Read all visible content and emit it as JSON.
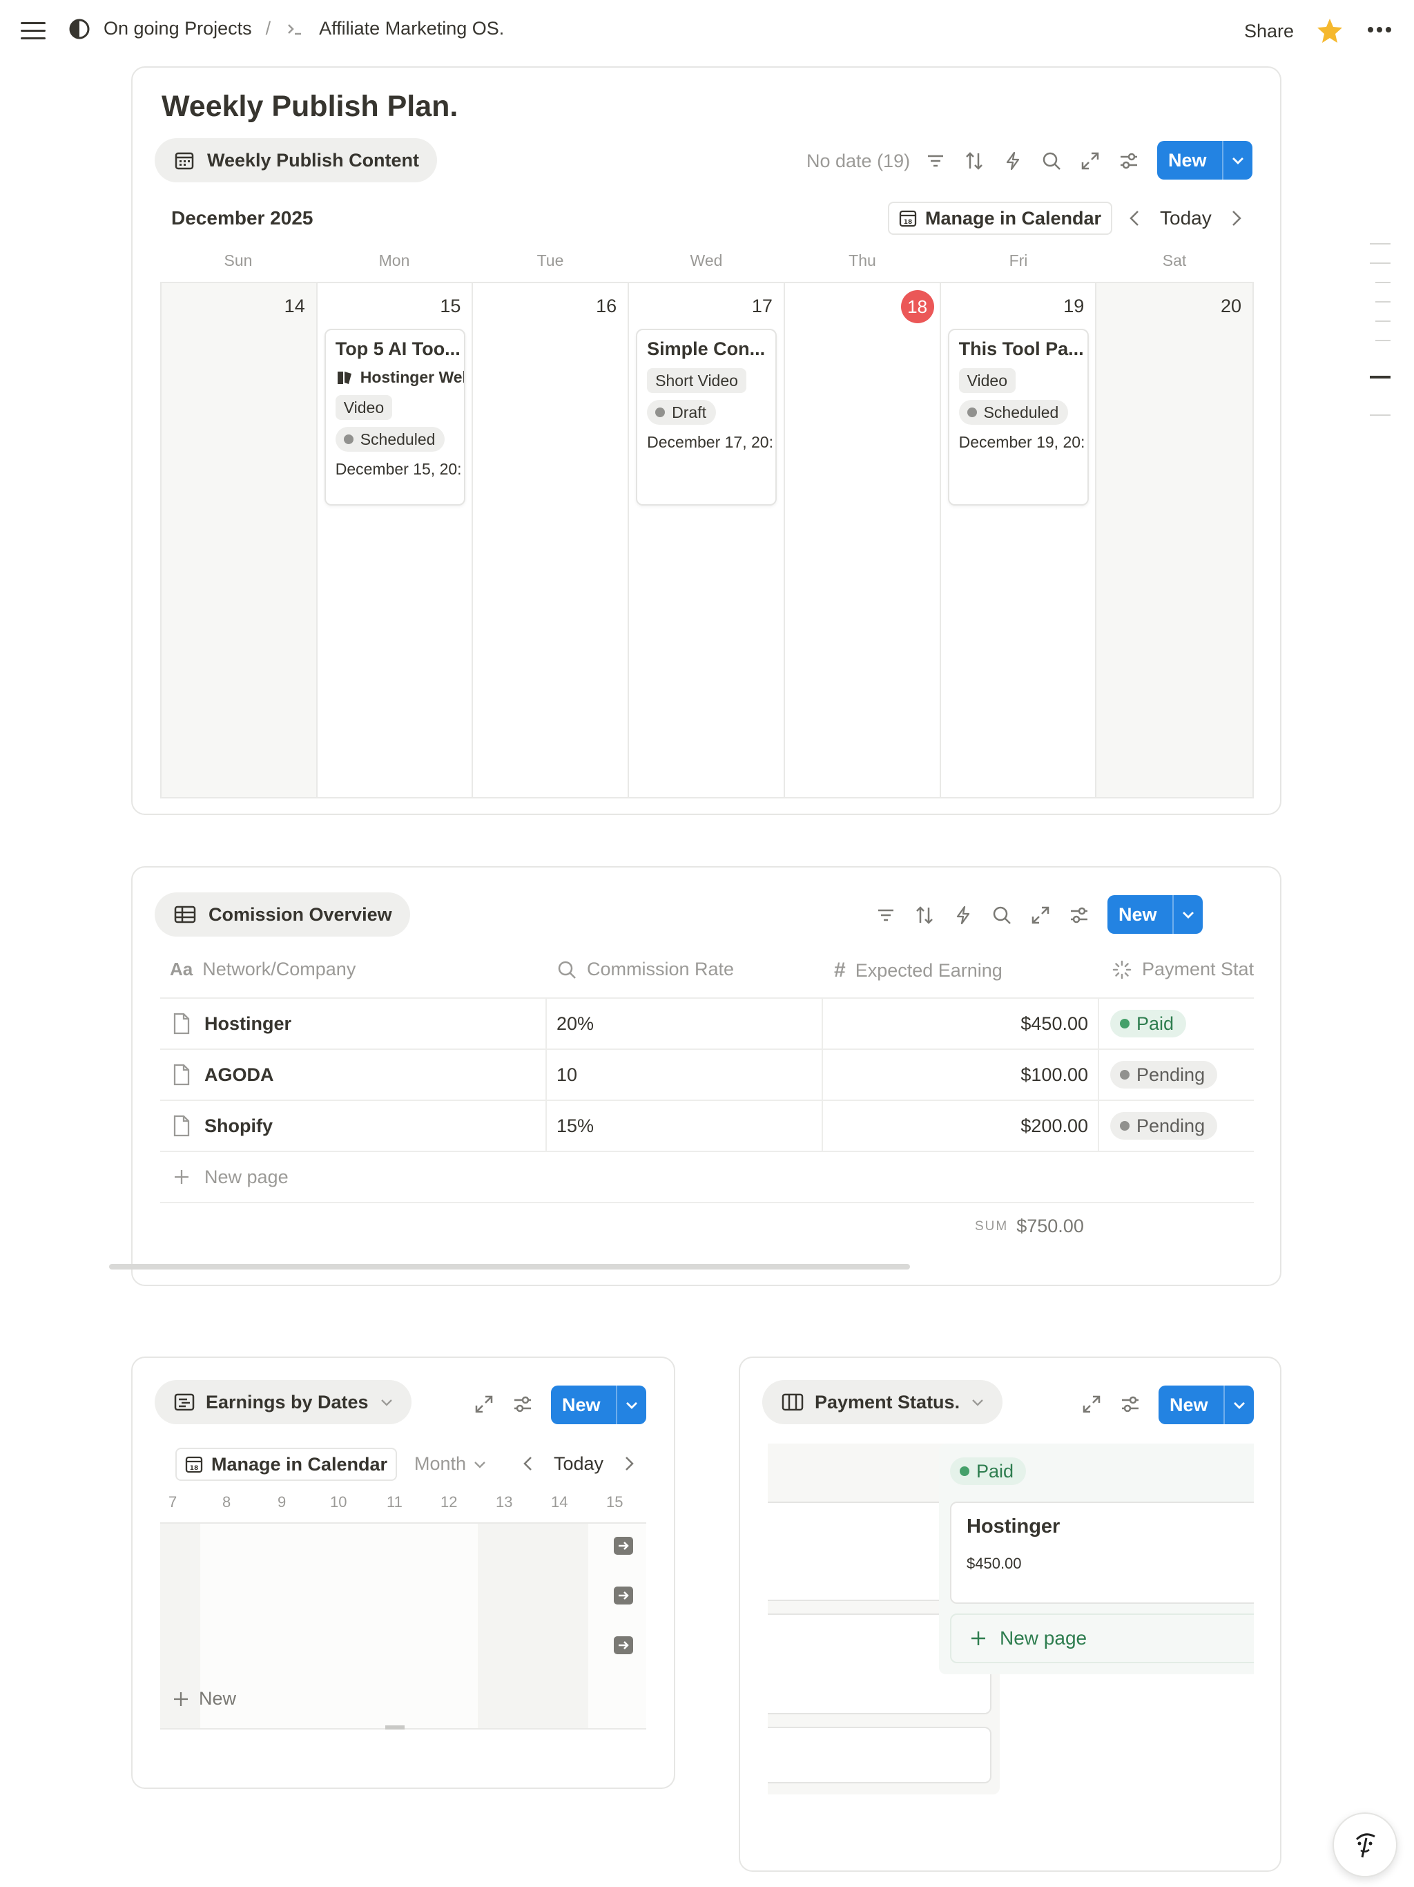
{
  "breadcrumb": {
    "workspace": "On going Projects",
    "separator": "/",
    "page": "Affiliate Marketing OS."
  },
  "topbar": {
    "share_label": "Share"
  },
  "publish_plan": {
    "title": "Weekly Publish Plan.",
    "view_label": "Weekly Publish Content",
    "no_date_label": "No date (19)",
    "new_label": "New",
    "month_label": "December 2025",
    "manage_label": "Manage in Calendar",
    "today_label": "Today",
    "weekdays": [
      "Sun",
      "Mon",
      "Tue",
      "Wed",
      "Thu",
      "Fri",
      "Sat"
    ],
    "days": [
      "14",
      "15",
      "16",
      "17",
      "18",
      "19",
      "20"
    ],
    "events": {
      "mon": {
        "title": "Top 5 AI Too...",
        "relation": "Hostinger Wel",
        "type": "Video",
        "status": "Scheduled",
        "date": "December 15, 20:"
      },
      "wed": {
        "title": "Simple Con...",
        "type": "Short Video",
        "status": "Draft",
        "date": "December 17, 20:"
      },
      "fri": {
        "title": "This Tool Pa...",
        "type": "Video",
        "status": "Scheduled",
        "date": "December 19, 20:"
      }
    }
  },
  "commission": {
    "view_label": "Comission Overview",
    "new_label": "New",
    "columns": [
      "Network/Company",
      "Commission Rate",
      "Expected Earning",
      "Payment Stat"
    ],
    "rows": [
      {
        "name": "Hostinger",
        "rate": "20%",
        "earning": "$450.00",
        "status": "Paid"
      },
      {
        "name": "AGODA",
        "rate": "10",
        "earning": "$100.00",
        "status": "Pending"
      },
      {
        "name": "Shopify",
        "rate": "15%",
        "earning": "$200.00",
        "status": "Pending"
      }
    ],
    "new_page_label": "New page",
    "sum_label": "SUM",
    "sum_value": "$750.00"
  },
  "earnings": {
    "view_label": "Earnings by Dates",
    "new_label": "New",
    "manage_label": "Manage in Calendar",
    "month_label": "Month",
    "today_label": "Today",
    "dates": [
      "7",
      "8",
      "9",
      "10",
      "11",
      "12",
      "13",
      "14",
      "15"
    ],
    "add_label": "New"
  },
  "payment": {
    "view_label": "Payment Status.",
    "new_label": "New",
    "group_label": "Paid",
    "card_title": "Hostinger",
    "card_amount": "$450.00",
    "new_page_label": "New page"
  },
  "colors": {
    "accent": "#2383e2",
    "today": "#eb5757",
    "star": "#f5b82e",
    "paid": "#2e7d4f"
  }
}
